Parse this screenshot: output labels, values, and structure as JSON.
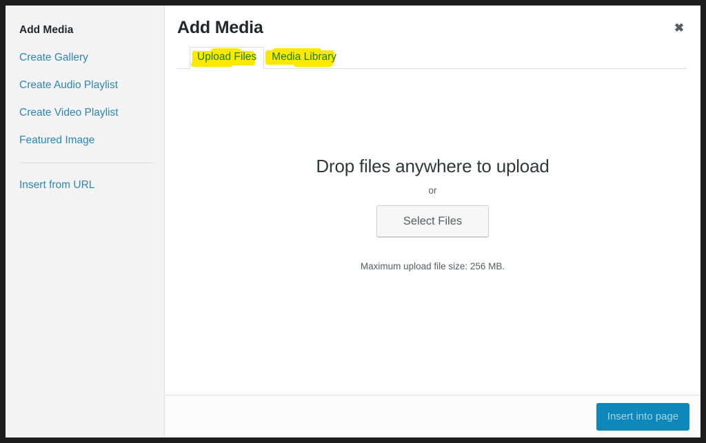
{
  "window": {
    "title": "Add Media",
    "close_label": "✖"
  },
  "sidebar": {
    "items": [
      {
        "label": "Add Media",
        "active": true
      },
      {
        "label": "Create Gallery",
        "active": false
      },
      {
        "label": "Create Audio Playlist",
        "active": false
      },
      {
        "label": "Create Video Playlist",
        "active": false
      },
      {
        "label": "Featured Image",
        "active": false
      }
    ],
    "secondary_items": [
      {
        "label": "Insert from URL",
        "active": false
      }
    ]
  },
  "tabs": [
    {
      "label": "Upload Files",
      "active": true,
      "highlighted": true
    },
    {
      "label": "Media Library",
      "active": false,
      "highlighted": true
    }
  ],
  "uploader": {
    "drop_instructions": "Drop files anywhere to upload",
    "or_label": "or",
    "select_files_label": "Select Files",
    "max_upload_size": "Maximum upload file size: 256 MB."
  },
  "toolbar": {
    "insert_label": "Insert into page"
  },
  "colors": {
    "link_blue": "#2d86b5",
    "title_dark": "#23282d",
    "highlighter_yellow": "#ffe800",
    "highlighted_link_green": "#15800f",
    "primary_button_blue": "#0e87ba",
    "sidebar_background": "#f3f3f3",
    "frame_dark": "#1d1d1d"
  }
}
